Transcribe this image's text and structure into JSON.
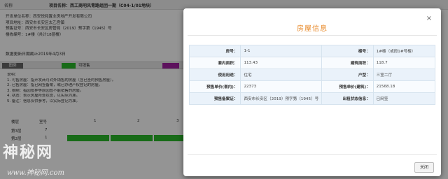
{
  "background": {
    "title_label": "名称",
    "title": "项目名称：西工商吧风青路组团一期（C04-1/01地块）",
    "info_lines": [
      "开发单位名称：西安悦和置业房地产开发有限公司",
      "项目地址：西安市长安区太乙宫镇",
      "预售证号：西安市长安区房管局（2019）预字第（1945）号",
      "楼栋编号：1#楼（共计18层楼）"
    ],
    "date_text": "数据更新日期截止2019年4月3日",
    "legend": {
      "first": "图例",
      "green_text": "可销售",
      "green_color": "#2ab82a",
      "purple_color": "#a020a0"
    },
    "notes": [
      "说明：",
      "1. 可售房屋：指开发商可对外销售的房屋（含已签约预售房屋）。",
      "2. 已售房屋：指已网签备案，或已办理产权登记的房屋。",
      "3. 限制：指因抵押等原因暂不能销售的房屋。",
      "4. 状态：表示房屋所处状态，以实际为准。",
      "5. 备注：信息仅供参考，以实际登记为准。"
    ],
    "table_headers": [
      "楼层",
      "室号",
      "1",
      "2",
      "3"
    ],
    "floors": [
      {
        "name": "第3层",
        "count": "7"
      },
      {
        "name": "第2层",
        "count": "1"
      }
    ]
  },
  "modal": {
    "title": "房屋信息",
    "close_icon": "close-icon",
    "rows": [
      {
        "k1": "房号：",
        "v1": "1-1",
        "k2": "楼号：",
        "v2": "1#楼（或段1#号楼）"
      },
      {
        "k1": "套内面积：",
        "v1": "113.43",
        "k2": "建筑面积：",
        "v2": "118.7"
      },
      {
        "k1": "使用用途：",
        "v1": "住宅",
        "k2": "户型：",
        "v2": "三室二厅"
      },
      {
        "k1": "预售单价(套内)：",
        "v1": "22373",
        "k2": "预售单价(建筑)：",
        "v2": "21568.18"
      },
      {
        "k1": "预售备案证：",
        "v1": "西安市长安区（2019）预字第（1945）号",
        "k2": "出租状态信息：",
        "v2": "已网签"
      }
    ],
    "close_button": "关闭"
  },
  "watermark": {
    "big": "神秘网",
    "small": "www.神秘网.com"
  }
}
